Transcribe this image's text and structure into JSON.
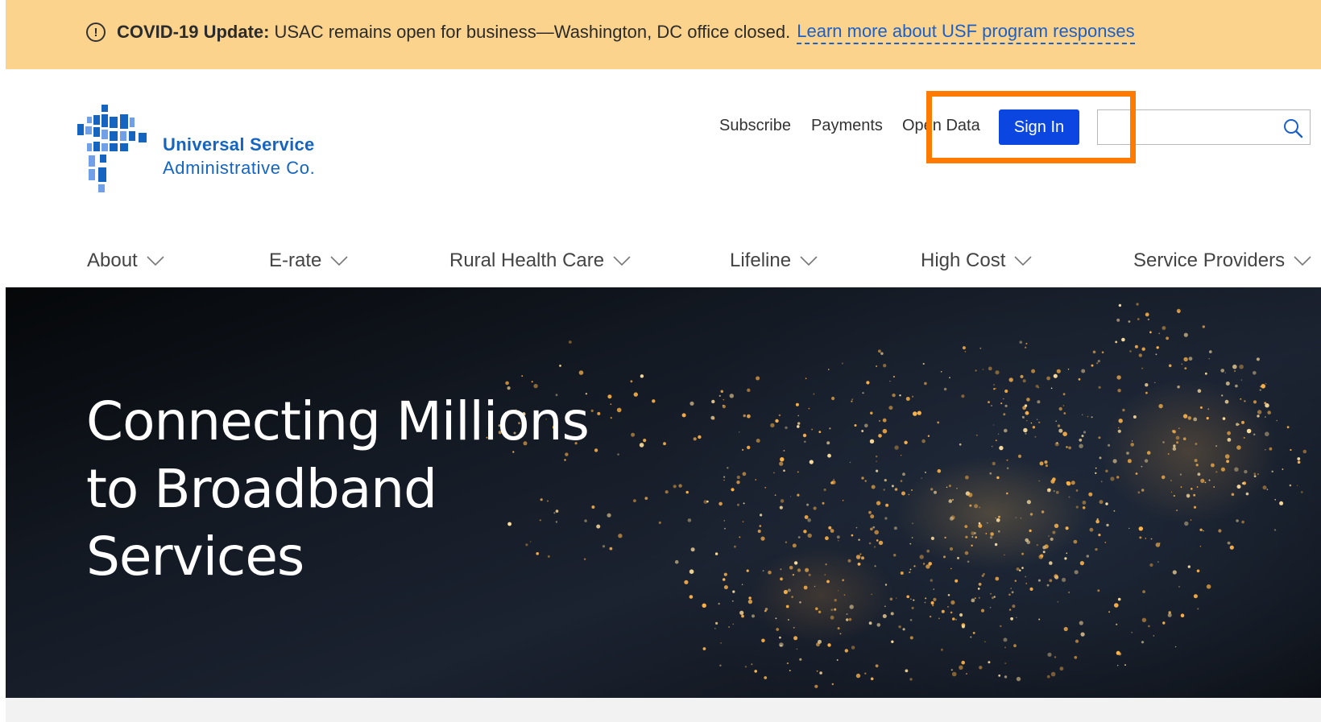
{
  "alert": {
    "strong": "COVID-19 Update:",
    "message": "USAC remains open for business—Washington, DC office closed.",
    "link": "Learn more about USF program responses"
  },
  "logo": {
    "line1": "Universal Service",
    "line2": "Administrative Co.",
    "color": "#1565c0"
  },
  "utility_nav": {
    "subscribe": "Subscribe",
    "payments": "Payments",
    "open_data": "Open Data"
  },
  "sign_in_label": "Sign In",
  "search": {
    "placeholder": "",
    "icon": "search-icon"
  },
  "main_nav": [
    {
      "label": "About"
    },
    {
      "label": "E-rate"
    },
    {
      "label": "Rural Health Care"
    },
    {
      "label": "Lifeline"
    },
    {
      "label": "High Cost"
    },
    {
      "label": "Service Providers"
    }
  ],
  "hero": {
    "line1": "Connecting Millions",
    "line2": "to Broadband",
    "line3": "Services"
  },
  "colors": {
    "alert_bg": "#fbd38d",
    "primary_button": "#0b46e0",
    "highlight": "#ff7a00",
    "link": "#1c5fc7"
  }
}
